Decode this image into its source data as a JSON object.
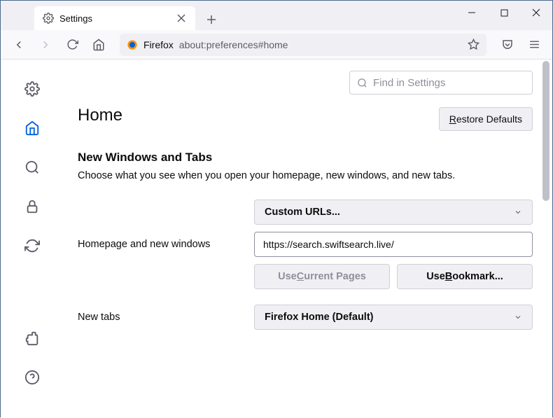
{
  "tab": {
    "title": "Settings"
  },
  "urlbar": {
    "brand": "Firefox",
    "url": "about:preferences#home"
  },
  "search": {
    "placeholder": "Find in Settings"
  },
  "page": {
    "heading": "Home",
    "restore_pre": "R",
    "restore_rest": "estore Defaults",
    "section_title": "New Windows and Tabs",
    "section_desc": "Choose what you see when you open your homepage, new windows, and new tabs."
  },
  "homepage": {
    "label": "Homepage and new windows",
    "select": "Custom URLs...",
    "url_value": "https://search.swiftsearch.live/",
    "use_current_pre": "Use ",
    "use_current_ul": "C",
    "use_current_rest": "urrent Pages",
    "use_bookmark_pre": "Use ",
    "use_bookmark_ul": "B",
    "use_bookmark_rest": "ookmark..."
  },
  "newtabs": {
    "label": "New tabs",
    "select": "Firefox Home (Default)"
  }
}
